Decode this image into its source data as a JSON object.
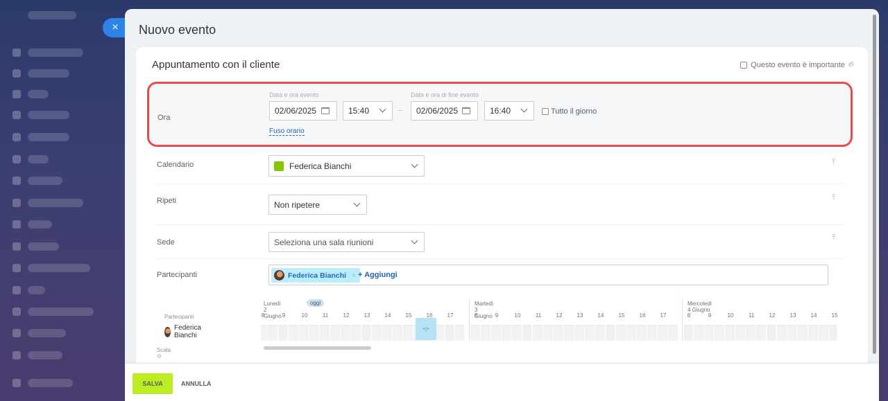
{
  "slider": {
    "title": "Nuovo evento",
    "close_icon": "×"
  },
  "event": {
    "name": "Appuntamento con il cliente",
    "important_label": "Questo evento è importante"
  },
  "time": {
    "row_label": "Ora",
    "start_caption": "Data e ora evento",
    "end_caption": "Data e ora di fine evento",
    "start_date": "02/06/2025",
    "start_time": "15:40",
    "separator": "–",
    "end_date": "02/06/2025",
    "end_time": "16:40",
    "all_day_label": "Tutto il giorno",
    "timezone_link": "Fuso orario"
  },
  "calendar": {
    "row_label": "Calendario",
    "value": "Federica Bianchi",
    "swatch_color": "#86c500"
  },
  "repeat": {
    "row_label": "Ripeti",
    "value": "Non ripetere"
  },
  "location": {
    "row_label": "Sede",
    "placeholder": "Seleziona una sala riunioni"
  },
  "attendees": {
    "row_label": "Partecipanti",
    "chip": "Federica Bianchi",
    "add_label": "+ Aggiungi"
  },
  "planner": {
    "participants_label": "Partecipanti",
    "participant_name": "Federica Bianchi",
    "scale_label": "Scala",
    "today_badge": "oggi",
    "now_marker": "+|+",
    "days": [
      {
        "label": "Lunedì 2 Giugno",
        "hours": [
          "8",
          "9",
          "10",
          "11",
          "12",
          "13",
          "14",
          "15",
          "16",
          "17"
        ]
      },
      {
        "label": "Martedì 3 Giugno",
        "hours": [
          "8",
          "9",
          "10",
          "11",
          "12",
          "13",
          "14",
          "15",
          "16",
          "17"
        ]
      },
      {
        "label": "Mercoledì 4 Giugno",
        "hours": [
          "8",
          "9",
          "10",
          "11",
          "12",
          "13",
          "14",
          "15"
        ]
      }
    ]
  },
  "footer": {
    "save_label": "SALVA",
    "cancel_label": "ANNULLA"
  }
}
